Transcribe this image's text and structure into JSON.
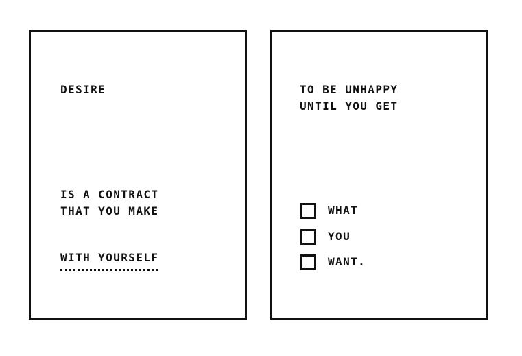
{
  "left_card": {
    "heading": "DESIRE",
    "line_1": "IS A CONTRACT",
    "line_2": "THAT YOU MAKE",
    "underlined_line": "WITH YOURSELF"
  },
  "right_card": {
    "line_1": "TO BE UNHAPPY",
    "line_2": "UNTIL YOU GET",
    "checklist": [
      {
        "label": "WHAT",
        "checked": false
      },
      {
        "label": "YOU",
        "checked": false
      },
      {
        "label": "WANT.",
        "checked": false
      }
    ]
  }
}
